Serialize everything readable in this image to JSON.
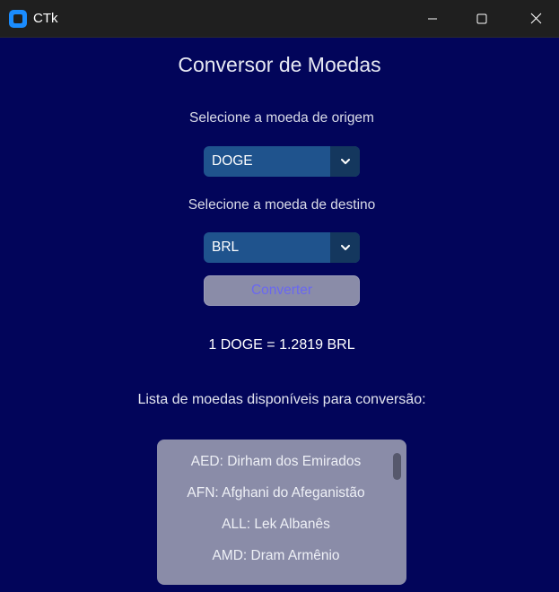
{
  "window": {
    "title": "CTk"
  },
  "app": {
    "title": "Conversor de Moedas",
    "origin_label": "Selecione a moeda de origem",
    "origin_value": "DOGE",
    "dest_label": "Selecione a moeda de destino",
    "dest_value": "BRL",
    "convert_label": "Converter",
    "result_text": "1 DOGE = 1.2819 BRL",
    "list_label": "Lista de moedas disponíveis para conversão:",
    "currencies": [
      "AED: Dirham dos Emirados",
      "AFN: Afghani do Afeganistão",
      "ALL: Lek Albanês",
      "AMD: Dram Armênio"
    ]
  },
  "icons": {
    "app": "ctk-app-icon",
    "minimize": "minimize-icon",
    "maximize": "maximize-icon",
    "close": "close-icon",
    "dropdown": "chevron-down-icon"
  },
  "colors": {
    "background": "#02055a",
    "titlebar": "#1f1f1f",
    "combo": "#1f538d",
    "combo_arrow": "#14375e",
    "button_disabled": "#8a8ca8",
    "listbox": "#8a8ca8"
  }
}
